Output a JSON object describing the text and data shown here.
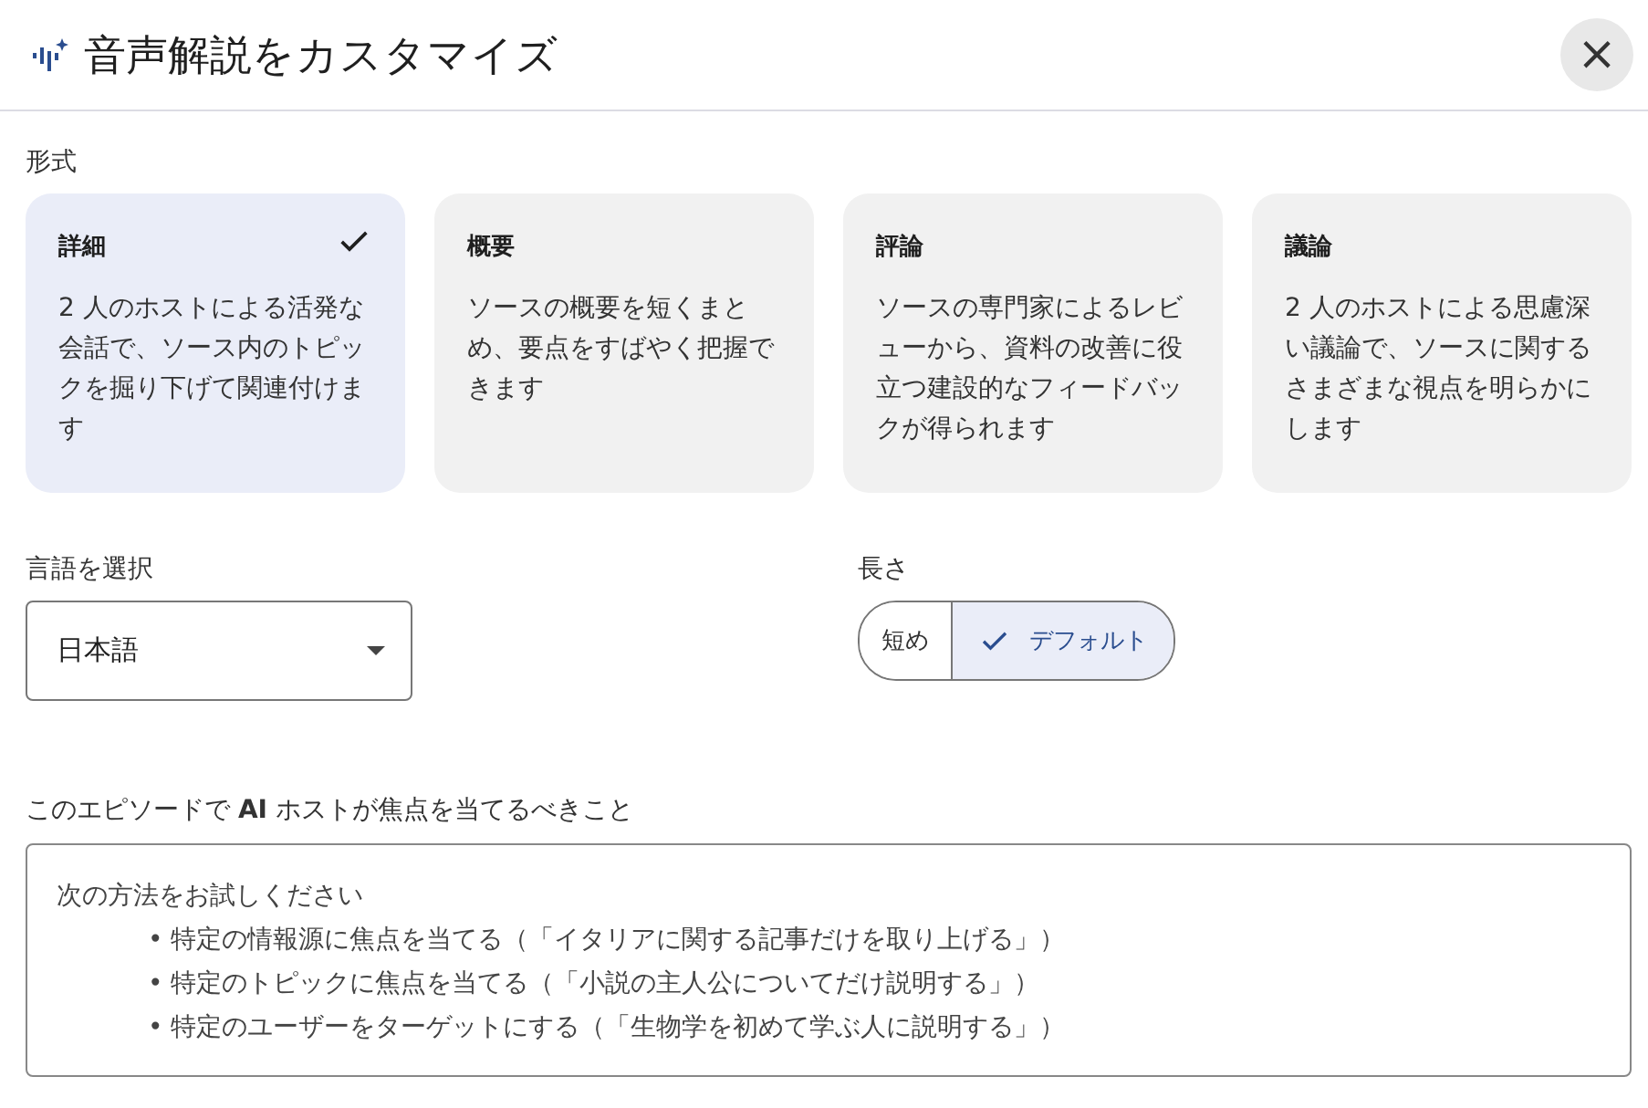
{
  "dialog": {
    "title": "音声解説をカスタマイズ",
    "close": "×"
  },
  "format": {
    "label": "形式",
    "options": [
      {
        "title": "詳細",
        "description": "2 人のホストによる活発な会話で、ソース内のトピックを掘り下げて関連付けます",
        "selected": true
      },
      {
        "title": "概要",
        "description": "ソースの概要を短くまとめ、要点をすばやく把握できます",
        "selected": false
      },
      {
        "title": "評論",
        "description": "ソースの専門家によるレビューから、資料の改善に役立つ建設的なフィードバックが得られます",
        "selected": false
      },
      {
        "title": "議論",
        "description": "2 人のホストによる思慮深い議論で、ソースに関するさまざまな視点を明らかにします",
        "selected": false
      }
    ]
  },
  "language": {
    "label": "言語を選択",
    "value": "日本語"
  },
  "length": {
    "label": "長さ",
    "options": [
      {
        "label": "短め",
        "selected": false
      },
      {
        "label": "デフォルト",
        "selected": true
      }
    ]
  },
  "focus": {
    "label": "このエピソードで **AI** ホストが焦点を当てるべきこと",
    "placeholder": {
      "intro": "次の方法をお試しください",
      "items": [
        "• 特定の情報源に焦点を当てる（「イタリアに関する記事だけを取り上げる」）",
        "• 特定のトピックに焦点を当てる（「小説の主人公についてだけ説明する」）",
        "• 特定のユーザーをターゲットにする（「生物学を初めて学ぶ人に説明する」）"
      ]
    }
  }
}
